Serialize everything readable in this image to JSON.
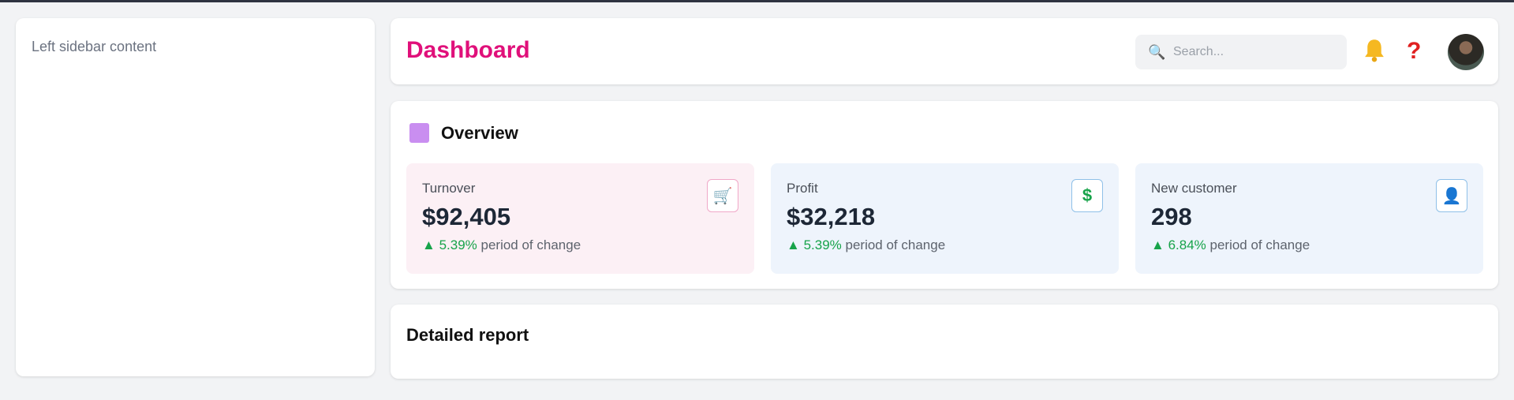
{
  "sidebar": {
    "text": "Left sidebar content"
  },
  "header": {
    "title": "Dashboard",
    "search_placeholder": "Search...",
    "search_icon": "🔍",
    "help_icon": "?"
  },
  "overview": {
    "title": "Overview",
    "stats": [
      {
        "label": "Turnover",
        "value": "$92,405",
        "change": "5.39%",
        "change_text": "period of change",
        "arrow": "▲",
        "icon": "🛒"
      },
      {
        "label": "Profit",
        "value": "$32,218",
        "change": "5.39%",
        "change_text": "period of change",
        "arrow": "▲",
        "icon": "$"
      },
      {
        "label": "New customer",
        "value": "298",
        "change": "6.84%",
        "change_text": "period of change",
        "arrow": "▲",
        "icon": "👤"
      }
    ]
  },
  "report": {
    "title": "Detailed report"
  },
  "colors": {
    "title_accent": "#e0107a",
    "positive": "#17a34a",
    "overview_icon": "#c98ef0"
  }
}
